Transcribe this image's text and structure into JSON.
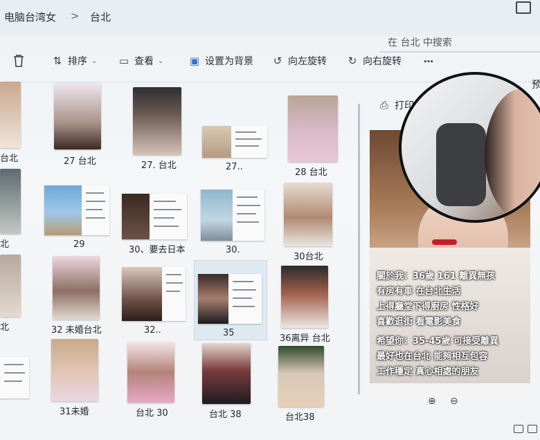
{
  "breadcrumb": {
    "root": "电脑台湾女",
    "separator": ">",
    "current": "台北"
  },
  "search": {
    "placeholder": "在 台北 中搜索"
  },
  "toolbar": {
    "sort_label": "排序",
    "view_label": "查看",
    "set_background_label": "设置为背景",
    "rotate_left_label": "向左旋转",
    "rotate_right_label": "向右旋转",
    "more_label": "…"
  },
  "preview_pane": {
    "print_label": "打印",
    "right_edge_label": "预"
  },
  "files": [
    {
      "name": "台北"
    },
    {
      "name": "27 台北"
    },
    {
      "name": "27. 台北"
    },
    {
      "name": "27.."
    },
    {
      "name": "28 台北"
    },
    {
      "name": "北"
    },
    {
      "name": "29"
    },
    {
      "name": "30、要去日本"
    },
    {
      "name": "30."
    },
    {
      "name": "30台北"
    },
    {
      "name": "北"
    },
    {
      "name": "32 未婚台北"
    },
    {
      "name": "32.."
    },
    {
      "name": "35"
    },
    {
      "name": "36离异 台北"
    },
    {
      "name": "31未婚"
    },
    {
      "name": "台北 30"
    },
    {
      "name": "台北 38"
    },
    {
      "name": "台北38"
    }
  ],
  "preview_text": [
    "關於我：36歲 161 離異無孩",
    "有房有車 在台北生活",
    "上得廳堂下得廚房 性格好",
    "喜歡逛街 看電影美食",
    "希望你：35-45歲 可接受離異",
    "最好也在台北 能夠相互包容",
    "工作穩定 真心相處的朋友"
  ],
  "icons": {
    "delete": "trash-icon",
    "sort": "sort-arrows-icon",
    "view": "view-icon",
    "background": "image-icon",
    "rotate_left": "rotate-left-icon",
    "rotate_right": "rotate-right-icon",
    "print": "print-icon",
    "zoom_in": "zoom-in-icon",
    "zoom_out": "zoom-out-icon"
  }
}
